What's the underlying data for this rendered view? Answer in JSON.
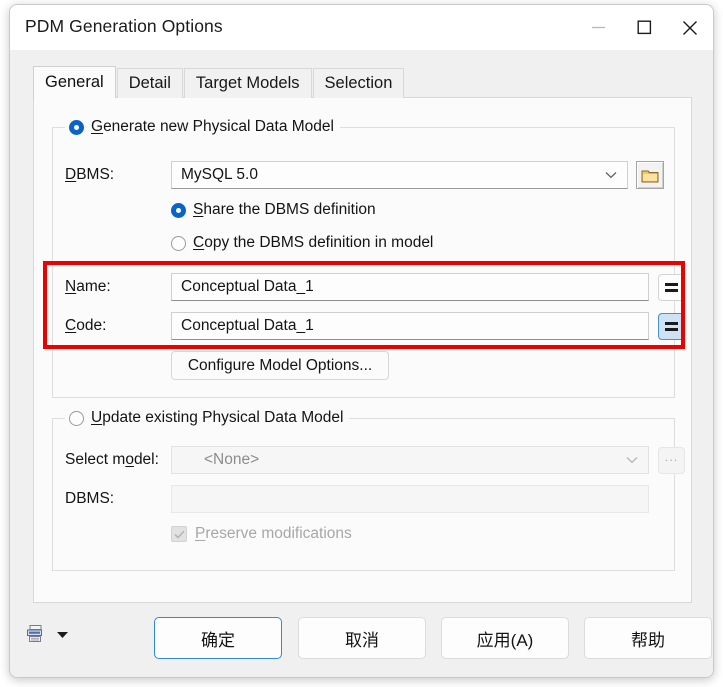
{
  "window": {
    "title": "PDM Generation Options",
    "caption_buttons": [
      {
        "name": "minimize",
        "glyph": "minimize-icon",
        "enabled": false
      },
      {
        "name": "maximize",
        "glyph": "maximize-icon",
        "enabled": true
      },
      {
        "name": "close",
        "glyph": "close-icon",
        "enabled": true
      }
    ]
  },
  "tabs": [
    {
      "label": "General",
      "active": true
    },
    {
      "label": "Detail",
      "active": false
    },
    {
      "label": "Target Models",
      "active": false
    },
    {
      "label": "Selection",
      "active": false
    }
  ],
  "generate_group": {
    "radio_label_pre": "G",
    "radio_label_post": "enerate new Physical Data Model",
    "selected": true,
    "dbms": {
      "label_pre": "D",
      "label_post": "BMS:",
      "value": "MySQL 5.0",
      "browse_icon": "folder-icon"
    },
    "share_option": {
      "pre": "S",
      "post": "hare the DBMS definition",
      "selected": true
    },
    "copy_option": {
      "pre": "C",
      "post": "opy the DBMS definition in model",
      "selected": false
    },
    "name_field": {
      "label_pre": "N",
      "label_post": "ame:",
      "value": "Conceptual Data_1",
      "side_button": "equals-icon",
      "side_button_focused": false
    },
    "code_field": {
      "label_pre": "C",
      "label_post": "ode:",
      "value": "Conceptual Data_1",
      "side_button": "equals-icon",
      "side_button_focused": true
    },
    "configure_button": "Configure Model Options..."
  },
  "update_group": {
    "radio_label_pre": "U",
    "radio_label_post": "pdate existing Physical Data Model",
    "selected": false,
    "select_model": {
      "label_pre": "Select m",
      "label_mid": "o",
      "label_post": "del:",
      "value": "<None>",
      "browse_button": "..."
    },
    "dbms": {
      "label": "DBMS:",
      "value": ""
    },
    "preserve": {
      "pre": "P",
      "post": "reserve modifications",
      "checked": true,
      "disabled": true
    }
  },
  "footer": {
    "print_icon": "print-options-icon",
    "dropdown_icon": "chevron-down-icon",
    "buttons": [
      {
        "label": "确定",
        "default": true
      },
      {
        "label": "取消",
        "default": false
      },
      {
        "label": "应用(A)",
        "default": false
      },
      {
        "label": "帮助",
        "default": false
      }
    ]
  },
  "annotation": {
    "type": "red-rectangle-highlight",
    "color": "#ef0000"
  }
}
